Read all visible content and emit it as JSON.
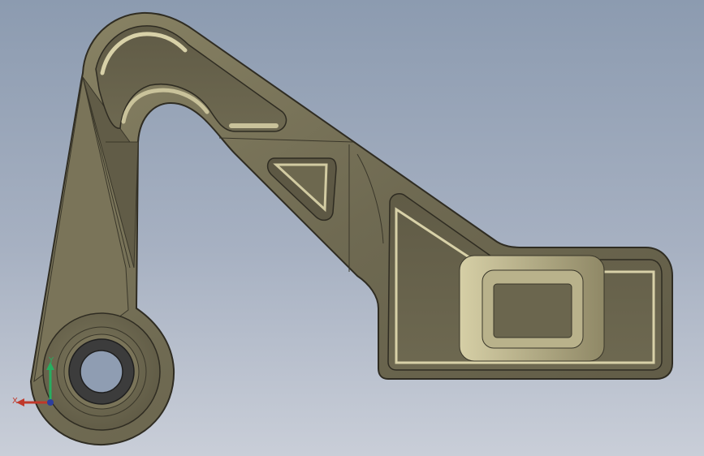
{
  "viewport": {
    "background_top": "#8c9bb0",
    "background_bottom": "#c9ced8"
  },
  "part": {
    "body_color": "#6f6a52",
    "edge_color": "#2f2c22",
    "highlight_color": "#c9c39a",
    "shadow_color": "#4d4938",
    "bore_color": "#3c3c3c"
  },
  "triad": {
    "x_label": "X",
    "y_label": "Y",
    "x_color": "#c0392b",
    "y_color": "#27ae60",
    "z_color": "#2c3e9e"
  }
}
